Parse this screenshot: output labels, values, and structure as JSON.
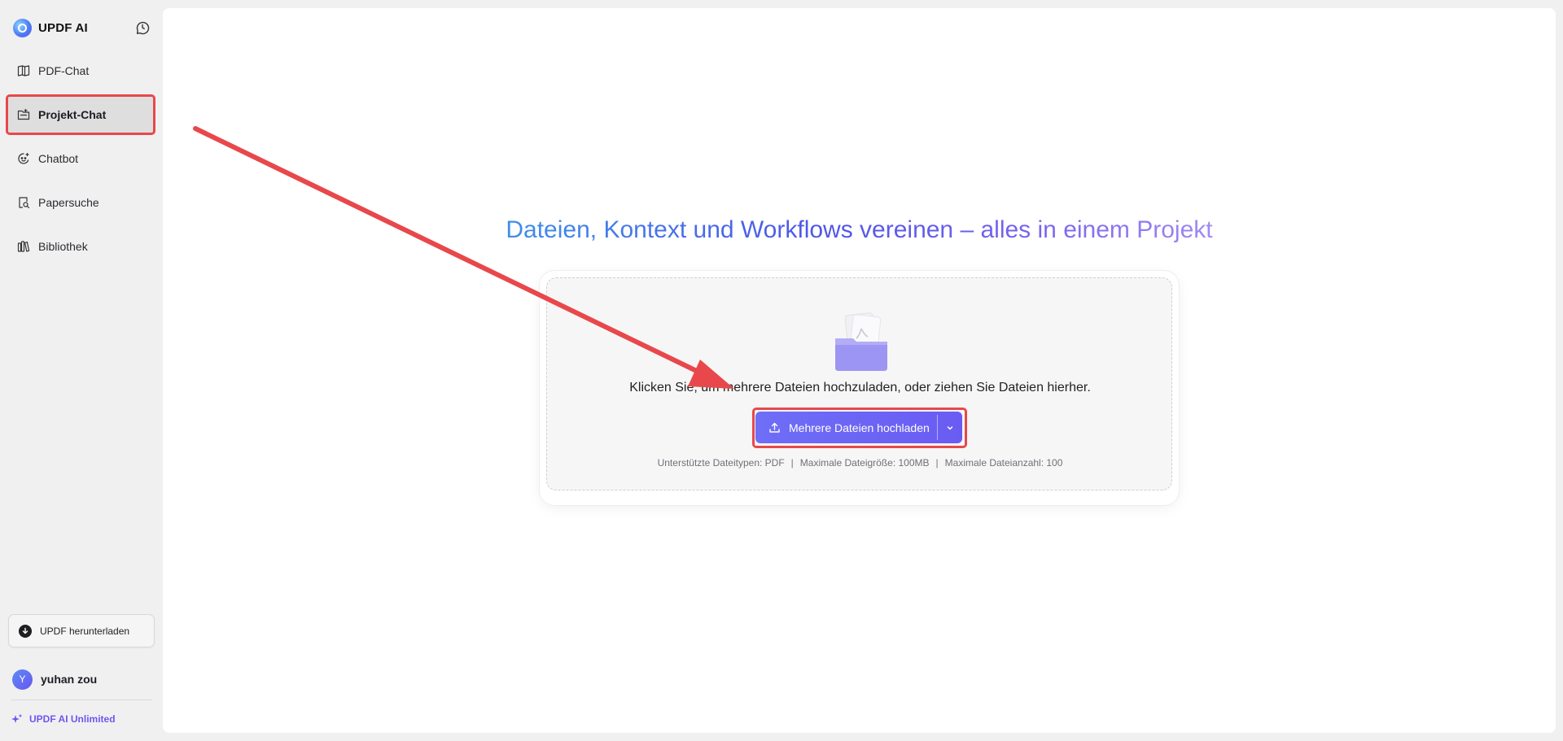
{
  "app": {
    "brand_name": "UPDF AI",
    "brand_icon": "updf-logo-icon",
    "history_icon": "history-chat-icon"
  },
  "sidebar": {
    "items": [
      {
        "label": "PDF-Chat",
        "icon": "book-open-icon",
        "active": false
      },
      {
        "label": "Projekt-Chat",
        "icon": "project-folder-icon",
        "active": true
      },
      {
        "label": "Chatbot",
        "icon": "bot-icon",
        "active": false
      },
      {
        "label": "Papersuche",
        "icon": "document-search-icon",
        "active": false
      },
      {
        "label": "Bibliothek",
        "icon": "library-icon",
        "active": false
      }
    ],
    "download_label": "UPDF herunterladen",
    "user": {
      "initial": "Y",
      "name": "yuhan zou"
    },
    "plan_label": "UPDF AI Unlimited"
  },
  "main": {
    "headline": "Dateien, Kontext und Workflows vereinen – alles in einem Projekt",
    "drop_text": "Klicken Sie, um mehrere Dateien hochzuladen, oder ziehen Sie Dateien hierher.",
    "upload_button_label": "Mehrere Dateien hochladen",
    "supported": {
      "types": "Unterstützte Dateitypen: PDF",
      "max_size": "Maximale Dateigröße: 100MB",
      "max_count": "Maximale Dateianzahl: 100"
    }
  },
  "colors": {
    "accent": "#6b5cf2",
    "annotation": "#e8484b",
    "sidebar_bg": "#f1f0f1"
  }
}
